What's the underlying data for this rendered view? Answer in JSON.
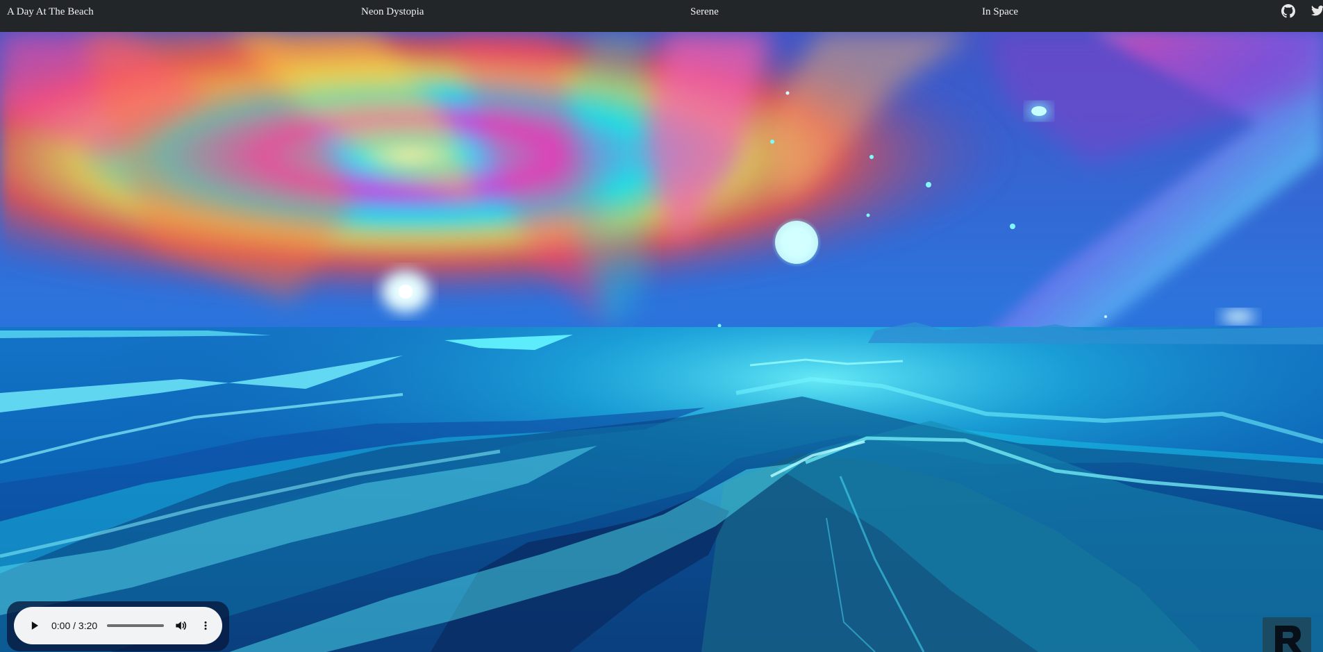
{
  "nav": {
    "items": [
      "A Day At The Beach",
      "Neon Dystopia",
      "Serene",
      "In Space"
    ]
  },
  "top_icons": {
    "github": "github-icon",
    "twitter": "twitter-icon"
  },
  "audio": {
    "time": "0:00 / 3:20",
    "progress": 0,
    "play_icon": "play-icon",
    "volume_icon": "volume-icon",
    "more_icon": "more-icon"
  },
  "colors": {
    "topbar": "#232629",
    "nav_text": "#f1f1f1",
    "audio_bg": "#f1f3f4",
    "logo_bg": "#1b4b63"
  }
}
